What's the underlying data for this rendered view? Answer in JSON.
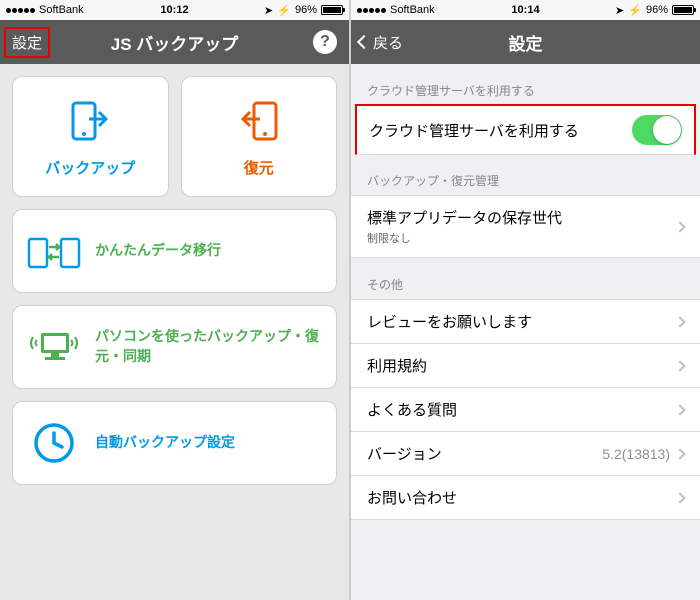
{
  "left": {
    "status": {
      "carrier": "SoftBank",
      "time": "10:12",
      "battery": "96%"
    },
    "nav": {
      "left_btn": "設定",
      "title": "JS バックアップ",
      "help": "?"
    },
    "cards": {
      "backup": "バックアップ",
      "restore": "復元",
      "migrate": "かんたんデータ移行",
      "pc": "パソコンを使ったバックアップ・復元・同期",
      "auto": "自動バックアップ設定"
    }
  },
  "right": {
    "status": {
      "carrier": "SoftBank",
      "time": "10:14",
      "battery": "96%"
    },
    "nav": {
      "back": "戻る",
      "title": "設定"
    },
    "sections": {
      "s1_header": "クラウド管理サーバを利用する",
      "s1_row": "クラウド管理サーバを利用する",
      "s2_header": "バックアップ・復元管理",
      "s2_row1": "標準アプリデータの保存世代",
      "s2_row1_sub": "制限なし",
      "s3_header": "その他",
      "s3_row1": "レビューをお願いします",
      "s3_row2": "利用規約",
      "s3_row3": "よくある質問",
      "s3_row4": "バージョン",
      "s3_row4_val": "5.2(13813)",
      "s3_row5": "お問い合わせ"
    }
  }
}
